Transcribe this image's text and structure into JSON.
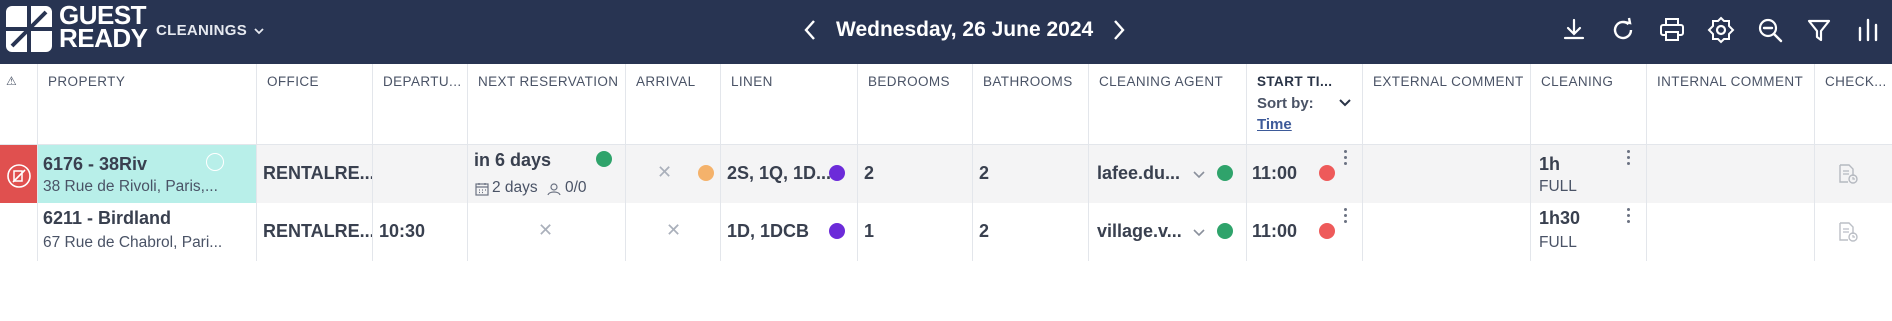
{
  "app": {
    "logo_text_line1": "GUEST",
    "logo_text_line2": "READY",
    "section_label": "CLEANINGS"
  },
  "date_nav": {
    "date": "Wednesday, 26 June 2024"
  },
  "toolbar": {
    "icons": [
      "download-icon",
      "refresh-icon",
      "print-icon",
      "settings-icon",
      "zoom-out-icon",
      "filter-icon",
      "columns-icon"
    ]
  },
  "columns": {
    "alert": "⚠",
    "property": "PROPERTY",
    "office": "OFFICE",
    "departure": "DEPARTU...",
    "next_reservation": "NEXT RESERVATION",
    "arrival": "ARRIVAL",
    "linen": "LINEN",
    "bedrooms": "BEDROOMS",
    "bathrooms": "BATHROOMS",
    "cleaning_agent": "CLEANING AGENT",
    "start_time": "START TI...",
    "sort_by_label": "Sort by:",
    "sort_by_value": "Time",
    "external_comment": "EXTERNAL COMMENT",
    "cleaning": "CLEANING",
    "internal_comment": "INTERNAL COMMENT",
    "checklist": "CHECK..."
  },
  "rows": [
    {
      "property_name": "6176 - 38Riv",
      "property_address": "38 Rue de Rivoli, Paris,...",
      "office": "RENTALRE...",
      "departure": "",
      "next_reservation": "in 6 days",
      "next_reservation_nights": "2 days",
      "next_reservation_guests": "0/0",
      "arrival": "",
      "linen": "2S, 1Q, 1D...",
      "bedrooms": "2",
      "bathrooms": "2",
      "cleaning_agent": "lafee.du...",
      "start_time": "11:00",
      "cleaning_duration": "1h",
      "cleaning_type": "FULL",
      "colors": {
        "next_res_dot": "#2fa36b",
        "arrival_dot": "#f4b26b",
        "linen_dot": "#6c2bd9",
        "agent_dot": "#2fa36b",
        "time_dot": "#ee5a5a",
        "alert_bg": "#e0504f",
        "property_bg": "#b8efe9"
      }
    },
    {
      "property_name": "6211 - Birdland",
      "property_address": "67 Rue de Chabrol, Pari...",
      "office": "RENTALRE...",
      "departure": "10:30",
      "next_reservation": "",
      "arrival": "",
      "linen": "1D, 1DCB",
      "bedrooms": "1",
      "bathrooms": "2",
      "cleaning_agent": "village.v...",
      "start_time": "11:00",
      "cleaning_duration": "1h30",
      "cleaning_type": "FULL",
      "colors": {
        "linen_dot": "#6c2bd9",
        "agent_dot": "#2fa36b",
        "time_dot": "#ee5a5a"
      }
    }
  ]
}
